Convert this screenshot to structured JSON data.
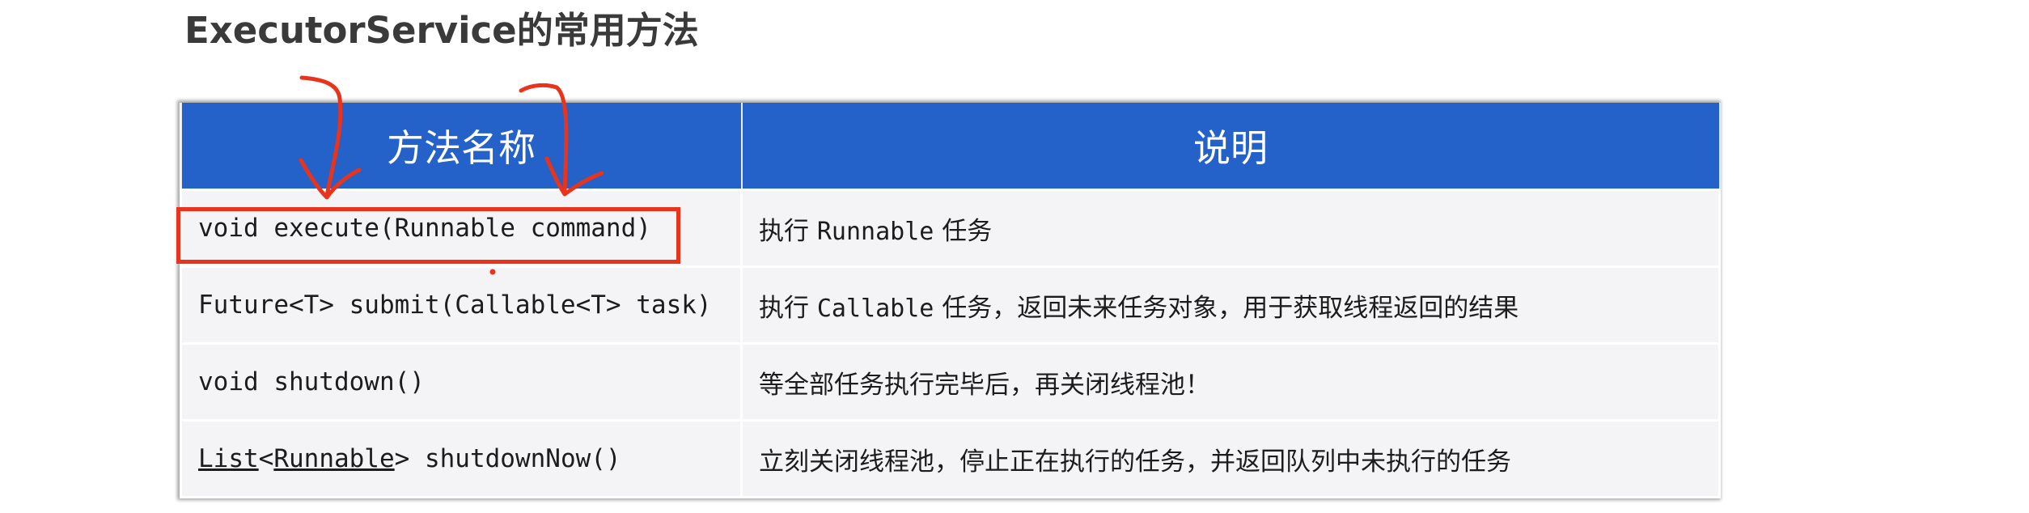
{
  "title": "ExecutorService的常用方法",
  "table": {
    "headers": [
      "方法名称",
      "说明"
    ],
    "rows": [
      {
        "signature": "void execute(Runnable command)",
        "description": {
          "pre": "执行 ",
          "code": "Runnable",
          "post": " 任务"
        }
      },
      {
        "signature": "Future<T> submit(Callable<T> task)",
        "description": {
          "pre": "执行 ",
          "code": "Callable",
          "post": " 任务，返回未来任务对象，用于获取线程返回的结果"
        }
      },
      {
        "signature": "void shutdown()",
        "description": {
          "pre": "等全部任务执行完毕后，再关闭线程池！"
        }
      },
      {
        "signature_parts": {
          "list": "List",
          "lt": "<",
          "runnable": "Runnable",
          "rest": "> shutdownNow()"
        },
        "description": {
          "pre": "立刻关闭线程池，停止正在执行的任务，并返回队列中未执行的任务"
        }
      }
    ]
  },
  "colors": {
    "header_bg": "#2461c8",
    "highlight": "#e8341c",
    "annotation": "#e8341c"
  }
}
